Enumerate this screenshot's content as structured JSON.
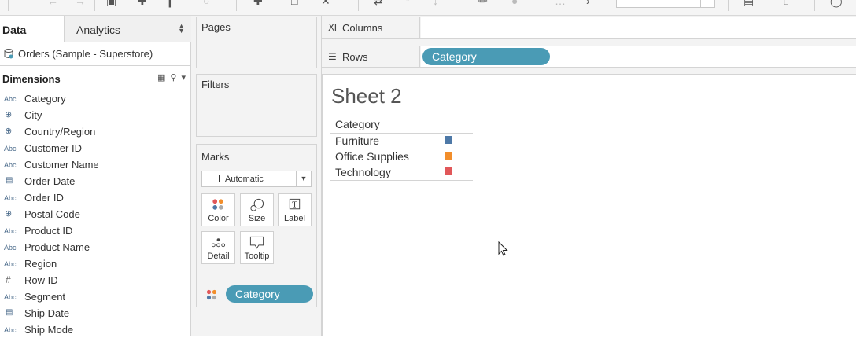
{
  "tabs": {
    "data": "Data",
    "analytics": "Analytics"
  },
  "datasource": {
    "name": "Orders (Sample - Superstore)"
  },
  "dimensions": {
    "title": "Dimensions",
    "items": [
      {
        "label": "Category",
        "type": "Abc"
      },
      {
        "label": "City",
        "type": "geo"
      },
      {
        "label": "Country/Region",
        "type": "geo"
      },
      {
        "label": "Customer ID",
        "type": "Abc"
      },
      {
        "label": "Customer Name",
        "type": "Abc"
      },
      {
        "label": "Order Date",
        "type": "date"
      },
      {
        "label": "Order ID",
        "type": "Abc"
      },
      {
        "label": "Postal Code",
        "type": "geo"
      },
      {
        "label": "Product ID",
        "type": "Abc"
      },
      {
        "label": "Product Name",
        "type": "Abc"
      },
      {
        "label": "Region",
        "type": "Abc"
      },
      {
        "label": "Row ID",
        "type": "#"
      },
      {
        "label": "Segment",
        "type": "Abc"
      },
      {
        "label": "Ship Date",
        "type": "date"
      },
      {
        "label": "Ship Mode",
        "type": "Abc"
      }
    ]
  },
  "cards": {
    "pages": "Pages",
    "filters": "Filters",
    "marks": "Marks"
  },
  "marks": {
    "type": "Automatic",
    "buttons": {
      "color": "Color",
      "size": "Size",
      "label": "Label",
      "detail": "Detail",
      "tooltip": "Tooltip"
    },
    "pill": "Category"
  },
  "shelves": {
    "columns": "Columns",
    "rows": "Rows",
    "rows_pill": "Category"
  },
  "sheet": {
    "title": "Sheet 2",
    "column_header": "Category",
    "rows": [
      {
        "label": "Furniture",
        "color": "#4e79a7"
      },
      {
        "label": "Office Supplies",
        "color": "#f28e2b"
      },
      {
        "label": "Technology",
        "color": "#e15759"
      }
    ]
  },
  "colors": {
    "pill": "#4a9bb5",
    "accent_blue": "#4e79a7"
  }
}
